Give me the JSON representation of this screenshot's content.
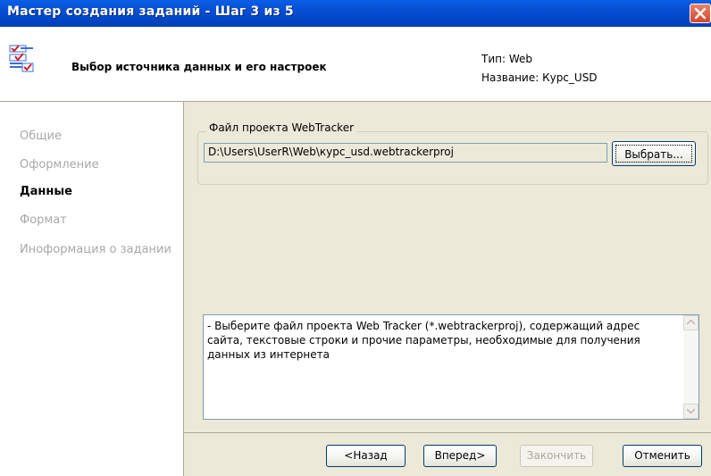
{
  "window": {
    "title": "Мастер создания заданий - Шаг 3 из 5"
  },
  "header": {
    "title": "Выбор источника данных и его настроек",
    "type_line": "Тип: Web",
    "name_line": "Название: Курс_USD"
  },
  "nav": {
    "items": [
      {
        "label": "Общие",
        "active": false
      },
      {
        "label": "Оформление",
        "active": false
      },
      {
        "label": "Данные",
        "active": true
      },
      {
        "label": "Формат",
        "active": false
      },
      {
        "label": "Иноформация о задании",
        "active": false
      }
    ]
  },
  "project_file": {
    "group_label": "Файл проекта WebTracker",
    "path_value": "D:\\Users\\UserR\\Web\\курс_usd.webtrackerproj",
    "browse_label": "Выбрать..."
  },
  "description": {
    "text": "- Выберите файл проекта Web Tracker (*.webtrackerproj), содержащий адрес сайта, текстовые строки и прочие параметры, необходимые для получения данных из интернета"
  },
  "footer": {
    "back_label": "<Назад",
    "next_label": "Вперед>",
    "finish_label": "Закончить",
    "cancel_label": "Отменить"
  },
  "colors": {
    "titlebar": "#0a5fe6",
    "close_button": "#d6462a",
    "panel_bg": "#ece9d8",
    "disabled_text": "#aca899"
  }
}
